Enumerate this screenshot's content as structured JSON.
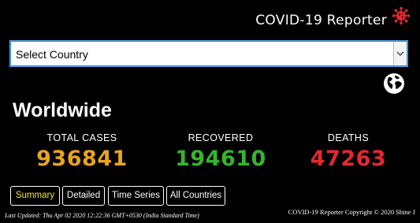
{
  "header": {
    "title": "COVID-19 Reporter",
    "icon": "virus-icon"
  },
  "select": {
    "value": "Select Country"
  },
  "region": {
    "title": "Worldwide"
  },
  "stats": {
    "cases": {
      "label": "TOTAL CASES",
      "value": "936841",
      "color": "#e8a321"
    },
    "recovered": {
      "label": "RECOVERED",
      "value": "194610",
      "color": "#36b52c"
    },
    "deaths": {
      "label": "DEATHS",
      "value": "47263",
      "color": "#e3282f"
    }
  },
  "tabs": [
    {
      "label": "Summary",
      "active": true
    },
    {
      "label": "Detailed",
      "active": false
    },
    {
      "label": "Time Series",
      "active": false
    },
    {
      "label": "All Countries",
      "active": false
    }
  ],
  "footer": {
    "updated": "Last Updated: Thu Apr 02 2020 12:22:36 GMT+0530 (India Standard Time)",
    "copyright": "COVID-19 Reporter Copyright © 2020 Shine J"
  },
  "colors": {
    "accent_tab": "#f2e22a",
    "virus": "#e3282f",
    "select_border": "#2e8bd8"
  }
}
